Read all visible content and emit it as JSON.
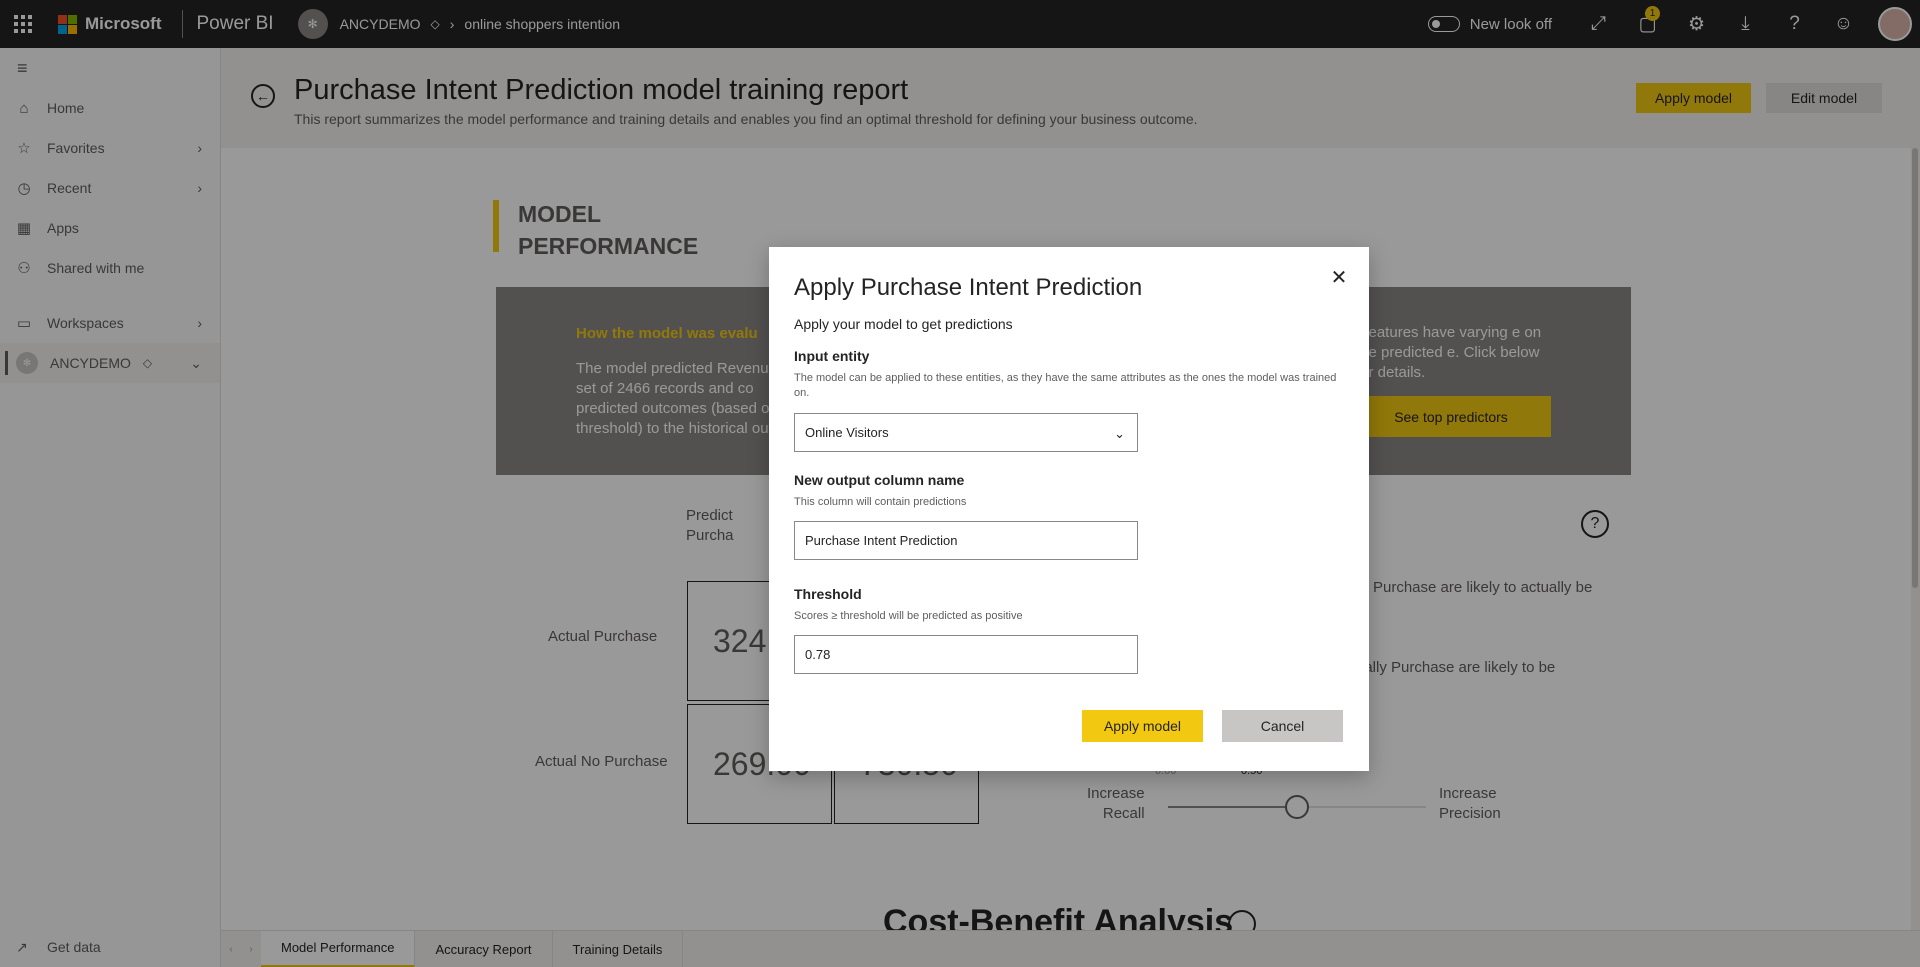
{
  "topbar": {
    "brand": "Microsoft",
    "product": "Power BI",
    "workspace": "ANCYDEMO",
    "report_name": "online shoppers intention",
    "new_look": "New look off",
    "notification_count": "1"
  },
  "nav": {
    "items": [
      {
        "label": "Home"
      },
      {
        "label": "Favorites"
      },
      {
        "label": "Recent"
      },
      {
        "label": "Apps"
      },
      {
        "label": "Shared with me"
      },
      {
        "label": "Workspaces"
      },
      {
        "label": "ANCYDEMO"
      }
    ],
    "get_data": "Get data"
  },
  "header": {
    "title": "Purchase Intent Prediction model training report",
    "subtitle": "This report summarizes the model performance and training details and enables you find an optimal threshold for defining your business outcome.",
    "apply_model": "Apply model",
    "edit_model": "Edit model"
  },
  "report": {
    "section_title_1": "MODEL",
    "section_title_2": "PERFORMANCE",
    "how_title": "How the model was evalu",
    "how_text": "The model predicted Revenue test set of 2466 records and co predicted outcomes (based on threshold) to the historical out",
    "right_text": "t features have varying e on the predicted e.  Click below for details.",
    "top_predictors": "See top predictors",
    "predicted_1": "Predict",
    "predicted_2": "Purcha",
    "actual_purchase": "Actual Purchase",
    "actual_no_purchase": "Actual No Purchase",
    "cell_1": "324.",
    "cell_3": "269.00",
    "cell_4": "730.50",
    "insight_1": "Purchase are likely to actually be",
    "insight_2": "ually Purchase are likely to be",
    "slider_min": "0.00",
    "slider_val": "0.50",
    "increase_recall_1": "Increase",
    "increase_recall_2": "Recall",
    "increase_precision_1": "Increase",
    "increase_precision_2": "Precision",
    "cost_benefit": "Cost-Benefit Analysis",
    "threshold_value": 0.5
  },
  "dialog": {
    "title": "Apply Purchase Intent Prediction",
    "subtitle": "Apply your model to get predictions",
    "input_entity_label": "Input entity",
    "input_entity_help": "The model can be applied to these entities, as they have the same attributes as the ones the model was trained on.",
    "input_entity_value": "Online Visitors",
    "output_col_label": "New output column name",
    "output_col_help": "This column will contain predictions",
    "output_col_value": "Purchase Intent Prediction",
    "threshold_label": "Threshold",
    "threshold_help": "Scores ≥ threshold will be predicted as positive",
    "threshold_value": "0.78",
    "apply": "Apply model",
    "cancel": "Cancel"
  },
  "tabs": [
    {
      "label": "Model Performance"
    },
    {
      "label": "Accuracy Report"
    },
    {
      "label": "Training Details"
    }
  ],
  "colors": {
    "accent": "#f2c811",
    "topbar": "#252423",
    "panel": "#8a8886"
  }
}
